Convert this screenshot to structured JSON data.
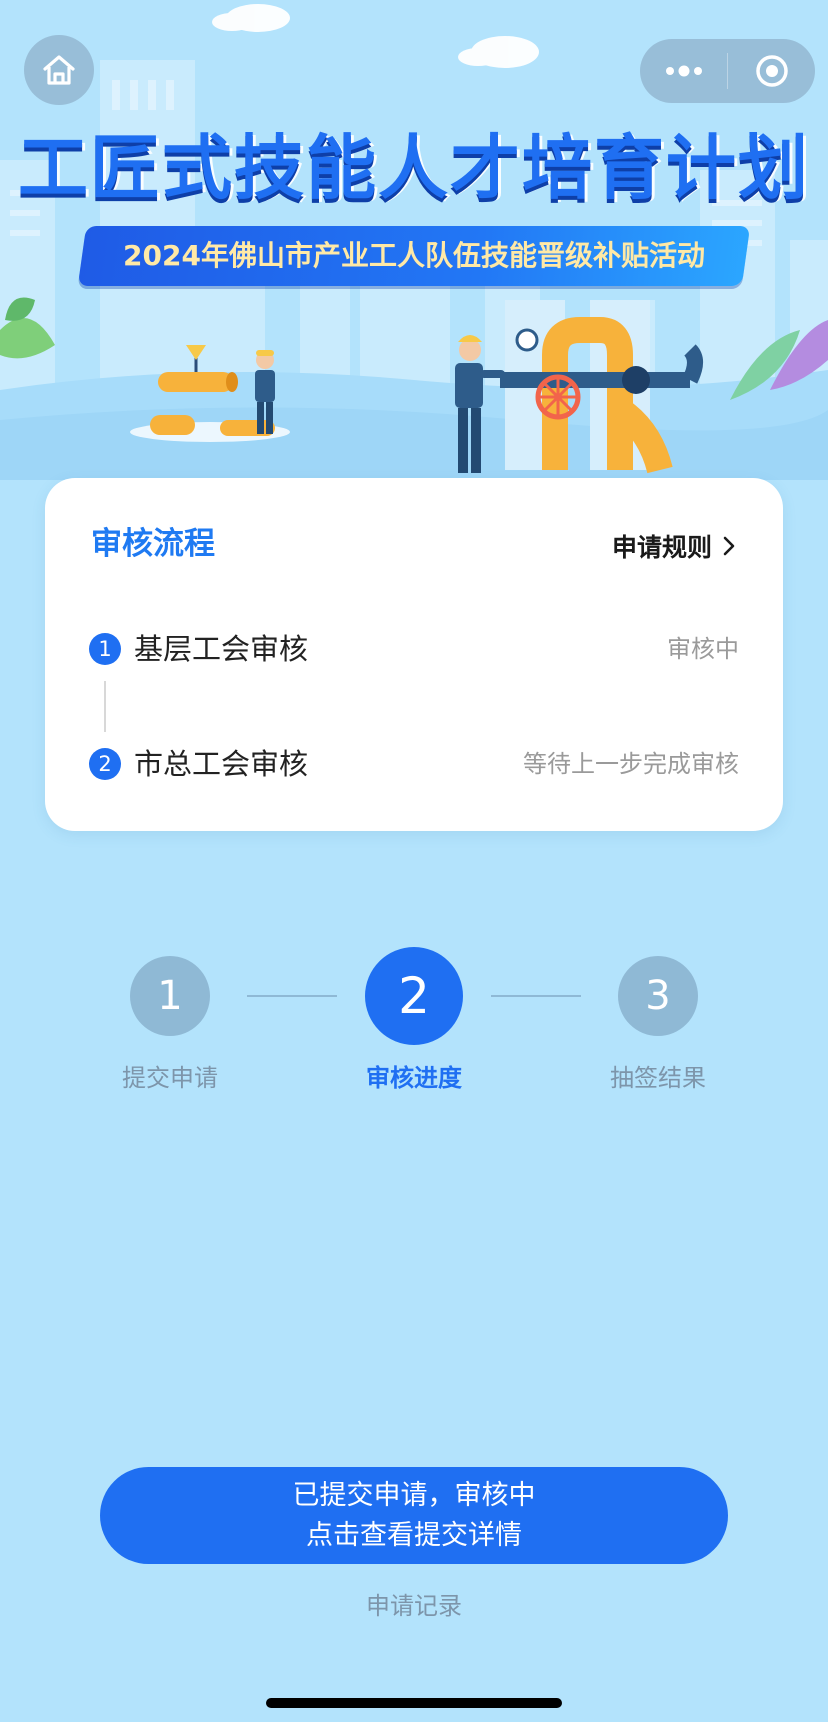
{
  "banner": {
    "title": "工匠式技能人才培育计划",
    "subtitle": "2024年佛山市产业工人队伍技能晋级补贴活动"
  },
  "nav": {
    "home_icon": "home-icon",
    "more_icon": "more-dots-icon",
    "close_icon": "target-close-icon"
  },
  "review": {
    "title": "审核流程",
    "rules_link": "申请规则",
    "steps": [
      {
        "num": "1",
        "name": "基层工会审核",
        "status": "审核中"
      },
      {
        "num": "2",
        "name": "市总工会审核",
        "status": "等待上一步完成审核"
      }
    ]
  },
  "progress": {
    "steps": [
      {
        "num": "1",
        "label": "提交申请",
        "active": false
      },
      {
        "num": "2",
        "label": "审核进度",
        "active": true
      },
      {
        "num": "3",
        "label": "抽签结果",
        "active": false
      }
    ]
  },
  "action": {
    "line1": "已提交申请，审核中",
    "line2": "点击查看提交详情",
    "record_link": "申请记录"
  },
  "colors": {
    "background": "#B3E3FC",
    "accent": "#1F6FF2",
    "inactive": "#8FB9D5",
    "muted_text": "#7D95AA"
  }
}
